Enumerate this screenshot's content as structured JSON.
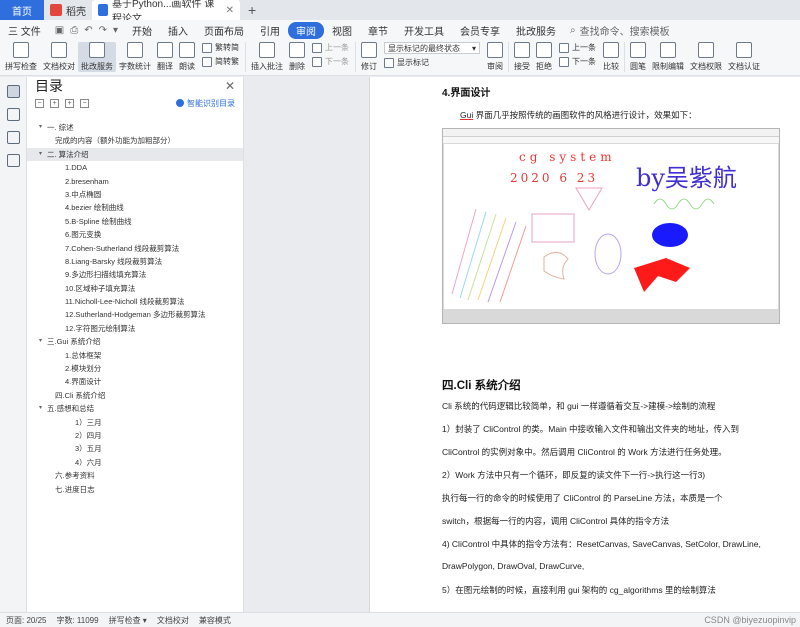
{
  "tabs": {
    "home": "首页",
    "tab1": "稻壳",
    "tab2": "基于Python...画软件 课程论文",
    "add": "+"
  },
  "menu": {
    "file": "三 文件",
    "items": [
      "开始",
      "插入",
      "页面布局",
      "引用",
      "审阅",
      "视图",
      "章节",
      "开发工具",
      "会员专享",
      "批改服务"
    ],
    "active": "审阅",
    "search": "查找命令、搜索模板"
  },
  "ribbon": {
    "spell": "拼写检查",
    "proof": "文档校对",
    "grading": "批改服务",
    "wordcount": "字数统计",
    "translate": "翻译",
    "read": "朗读",
    "trad": "繁转简",
    "simp": "简转繁",
    "insert_comment": "插入批注",
    "delete": "删除",
    "prev": "上一条",
    "next": "下一条",
    "revise": "修订",
    "markup_state": "显示标记的最终状态",
    "show_markup": "显示标记",
    "review": "审阅",
    "accept": "接受",
    "reject": "拒绝",
    "prev2": "上一条",
    "next2": "下一条",
    "compare": "比较",
    "ink": "圆笔",
    "restrict": "限制编辑",
    "perm": "文档权限",
    "certify": "文档认证"
  },
  "toc": {
    "title": "目录",
    "smart": "智能识别目录",
    "items": [
      {
        "text": "一. 综述",
        "level": 1,
        "caret": true
      },
      {
        "text": "完成的内容（额外功能为加粗部分）",
        "level": 2
      },
      {
        "text": "二. 算法介绍",
        "level": 1,
        "caret": true,
        "selected": true
      },
      {
        "text": "1.DDA",
        "level": 3
      },
      {
        "text": "2.bresenham",
        "level": 3
      },
      {
        "text": "3.中点椭圆",
        "level": 3
      },
      {
        "text": "4.bezier 绘制曲线",
        "level": 3
      },
      {
        "text": "5.B-Spline 绘制曲线",
        "level": 3
      },
      {
        "text": "6.图元变换",
        "level": 3
      },
      {
        "text": "7.Cohen-Sutherland 线段裁剪算法",
        "level": 3
      },
      {
        "text": "8.Liang-Barsky 线段裁剪算法",
        "level": 3
      },
      {
        "text": "9.多边形扫描线填充算法",
        "level": 3
      },
      {
        "text": "10.区域种子填充算法",
        "level": 3
      },
      {
        "text": "11.Nicholl-Lee-Nicholl 线段裁剪算法",
        "level": 3
      },
      {
        "text": "12.Sutherland-Hodgeman 多边形裁剪算法",
        "level": 3
      },
      {
        "text": "12.字符图元绘制算法",
        "level": 3
      },
      {
        "text": "三.Gui 系统介绍",
        "level": 1,
        "caret": true
      },
      {
        "text": "1.总体框架",
        "level": 3
      },
      {
        "text": "2.模块划分",
        "level": 3
      },
      {
        "text": "4.界面设计",
        "level": 3
      },
      {
        "text": "四.Cli 系统介绍",
        "level": 2
      },
      {
        "text": "五.感想和总结",
        "level": 1,
        "caret": true
      },
      {
        "text": "1）三月",
        "level": 4
      },
      {
        "text": "2）四月",
        "level": 4
      },
      {
        "text": "3）五月",
        "level": 4
      },
      {
        "text": "4）六月",
        "level": 4
      },
      {
        "text": "六.参考资料",
        "level": 2
      },
      {
        "text": "七.进度日志",
        "level": 2
      }
    ]
  },
  "doc": {
    "h_ui": "4.界面设计",
    "p_ui_a": "Gui",
    "p_ui_b": " 界面几乎按照传统的画图软件的风格进行设计，效果如下：",
    "figure": {
      "line1": "cg system",
      "line2": "2020 6 23",
      "sign": "by吴紫航"
    },
    "h_cli": "四.Cli 系统介绍",
    "lines": [
      "Cli 系统的代码逻辑比较简单，和 gui 一样遵循着交互->建模->绘制的流程",
      "1）封装了 CliControl 的类。Main 中接收输入文件和输出文件夹的地址，传入到",
      "CliControl 的实例对象中。然后调用 CliControl 的 Work 方法进行任务处理。",
      "2）Work          方法中只有一个循环，即反复的读文件下一行->执行这一行3)",
      "执行每一行的命令的时候使用了 CliControl 的 ParseLine 方法，本质是一个",
      "switch，根据每一行的内容，调用 CliControl 具体的指令方法",
      "4) CliControl 中具体的指令方法有：ResetCanvas, SaveCanvas, SetColor, DrawLine,",
      "DrawPolygon, DrawOval, DrawCurve,",
      "5）在图元绘制的时候，直接利用 gui 架构的 cg_algorithms 里的绘制算法"
    ]
  },
  "status": {
    "page": "页面: 20/25",
    "words": "字数: 11099",
    "spell": "拼写检查 ▾",
    "proof": "文档校对",
    "compat": "兼容模式",
    "watermark": "CSDN @biyezuopinvip"
  },
  "colors": {
    "accent": "#2f6fdd",
    "tab_red": "#e2463d",
    "fig_text_red": "#e53935",
    "fig_text_blue": "#3f2fd0",
    "fig_blue": "#1a1aff",
    "fig_red": "#ff1a1a"
  }
}
